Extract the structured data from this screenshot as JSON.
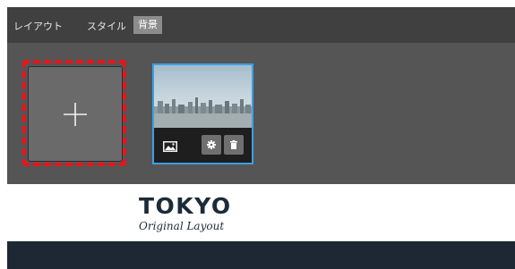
{
  "tabs": [
    {
      "label": "レイアウト",
      "active": false
    },
    {
      "label": "スタイル",
      "active": false
    },
    {
      "label": "背景",
      "active": true
    }
  ],
  "add_tile": {
    "icon": "plus-icon"
  },
  "thumbnail": {
    "icons": [
      "image-icon",
      "gear-icon",
      "trash-icon"
    ]
  },
  "logo": {
    "title": "TOKYO",
    "subtitle": "Original Layout"
  },
  "colors": {
    "panel": "#555555",
    "tabbar": "#404040",
    "active_tab": "#8c8c8c",
    "highlight_dash": "#e8141b",
    "selected_border": "#3ba0e6",
    "logo_text": "#1c2b3a",
    "footer_band": "#1d2834"
  }
}
